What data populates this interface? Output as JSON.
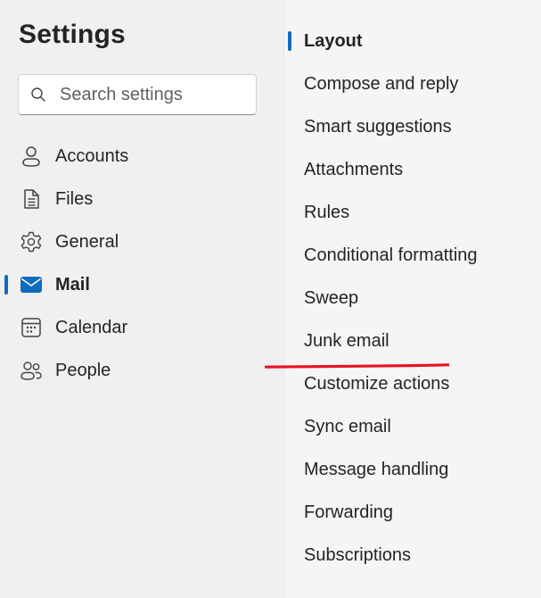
{
  "settings": {
    "title": "Settings",
    "search": {
      "placeholder": "Search settings",
      "value": ""
    }
  },
  "nav": {
    "items": [
      {
        "label": "Accounts",
        "icon": "person-icon",
        "selected": false
      },
      {
        "label": "Files",
        "icon": "document-icon",
        "selected": false
      },
      {
        "label": "General",
        "icon": "gear-icon",
        "selected": false
      },
      {
        "label": "Mail",
        "icon": "mail-icon",
        "selected": true
      },
      {
        "label": "Calendar",
        "icon": "calendar-icon",
        "selected": false
      },
      {
        "label": "People",
        "icon": "people-icon",
        "selected": false
      }
    ]
  },
  "mail_settings": {
    "items": [
      {
        "label": "Layout",
        "selected": true
      },
      {
        "label": "Compose and reply",
        "selected": false
      },
      {
        "label": "Smart suggestions",
        "selected": false
      },
      {
        "label": "Attachments",
        "selected": false
      },
      {
        "label": "Rules",
        "selected": false
      },
      {
        "label": "Conditional formatting",
        "selected": false
      },
      {
        "label": "Sweep",
        "selected": false
      },
      {
        "label": "Junk email",
        "selected": false
      },
      {
        "label": "Customize actions",
        "selected": false
      },
      {
        "label": "Sync email",
        "selected": false
      },
      {
        "label": "Message handling",
        "selected": false
      },
      {
        "label": "Forwarding",
        "selected": false
      },
      {
        "label": "Subscriptions",
        "selected": false
      }
    ]
  },
  "colors": {
    "accent": "#0f6cbd",
    "annotation": "#e81123",
    "background": "#f0f0f0",
    "text": "#242424"
  }
}
